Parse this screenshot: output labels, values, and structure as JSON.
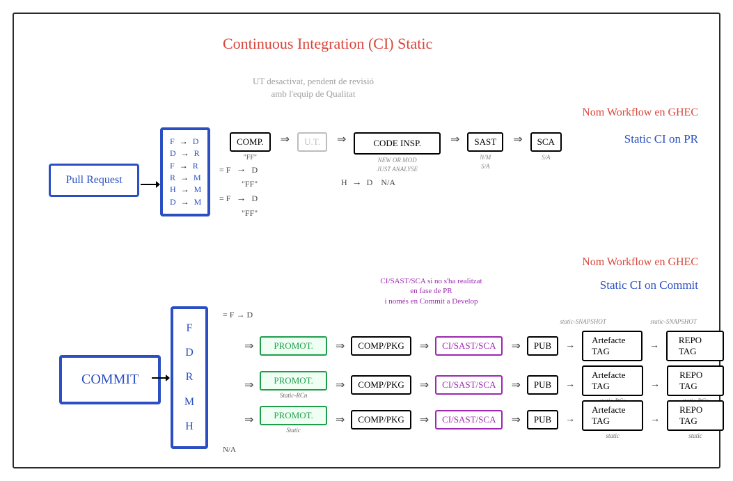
{
  "title": "Continuous Integration (CI) Static",
  "ut_note_line1": "UT desactivat, pendent de revisió",
  "ut_note_line2": "amb l'equip de Qualitat",
  "ghec_label": "Nom Workflow en GHEC",
  "ghec_pr": "Static CI on PR",
  "ghec_commit": "Static CI on Commit",
  "pr": {
    "event": "Pull Request",
    "merges": [
      {
        "from": "F",
        "to": "D"
      },
      {
        "from": "D",
        "to": "R"
      },
      {
        "from": "F",
        "to": "R"
      },
      {
        "from": "R",
        "to": "M"
      },
      {
        "from": "H",
        "to": "M"
      },
      {
        "from": "D",
        "to": "M"
      }
    ],
    "chain": {
      "comp": {
        "label": "COMP.",
        "sub": "\"FF\""
      },
      "ut": {
        "label": "U.T."
      },
      "code": {
        "label": "CODE INSP.",
        "sub1": "NEW OR MOD",
        "sub2": "JUST ANALYSE"
      },
      "sast": {
        "label": "SAST",
        "sub1": "N/M",
        "sub2": "S/A"
      },
      "sca": {
        "label": "SCA",
        "sub": "S/A"
      }
    },
    "eq_rows": [
      {
        "pre": "= F",
        "to": "D",
        "post": ""
      },
      {
        "pre": "",
        "to": "",
        "post": "\"FF\""
      },
      {
        "pre": "= F",
        "to": "D",
        "post": ""
      },
      {
        "pre": "",
        "to": "",
        "post": "\"FF\""
      }
    ],
    "h_row": {
      "h": "H",
      "to": "D",
      "na": "N/A"
    }
  },
  "commit": {
    "event": "COMMIT",
    "branches": [
      "F",
      "D",
      "R",
      "M",
      "H"
    ],
    "eq": "= F  →  D",
    "na": "N/A",
    "purple_note": "CI/SAST/SCA si no s'ha realitzat\nen fase de PR\ni només en Commit a Develop",
    "cols": {
      "promot": "PROMOT.",
      "comp": "COMP/PKG",
      "cisast": "CI/SAST/SCA",
      "pub": "PUB",
      "arttag": "Artefacte TAG",
      "repotag": "REPO TAG"
    },
    "subs": {
      "row2_promot": "Static-RCn",
      "row3_promot": "Static",
      "snap": "static-SNAPSHOT",
      "rcn": "static-RCn",
      "static": "static"
    }
  }
}
